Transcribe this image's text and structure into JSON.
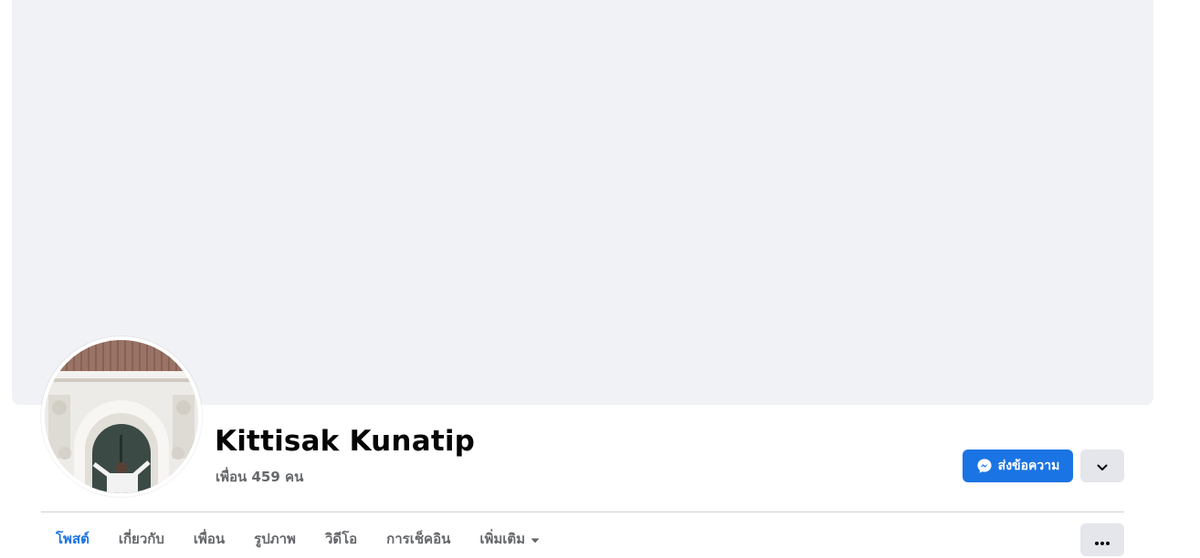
{
  "profile": {
    "name": "Kittisak Kunatip",
    "friends_text": "เพื่อน 459 คน"
  },
  "actions": {
    "message_label": "ส่งข้อความ",
    "message_icon": "messenger-icon",
    "dropdown_icon": "chevron-down-icon",
    "more_icon": "ellipsis-icon"
  },
  "tabs": [
    {
      "label": "โพสต์",
      "active": true
    },
    {
      "label": "เกี่ยวกับ",
      "active": false
    },
    {
      "label": "เพื่อน",
      "active": false
    },
    {
      "label": "รูปภาพ",
      "active": false
    },
    {
      "label": "วิดีโอ",
      "active": false
    },
    {
      "label": "การเช็คอิน",
      "active": false
    },
    {
      "label": "เพิ่มเติม",
      "active": false,
      "icon": "caret-down-icon"
    }
  ],
  "colors": {
    "accent": "#1b74e4",
    "cover_background": "#f0f2f5",
    "secondary_button": "#e4e6eb",
    "secondary_text": "#65676b"
  }
}
